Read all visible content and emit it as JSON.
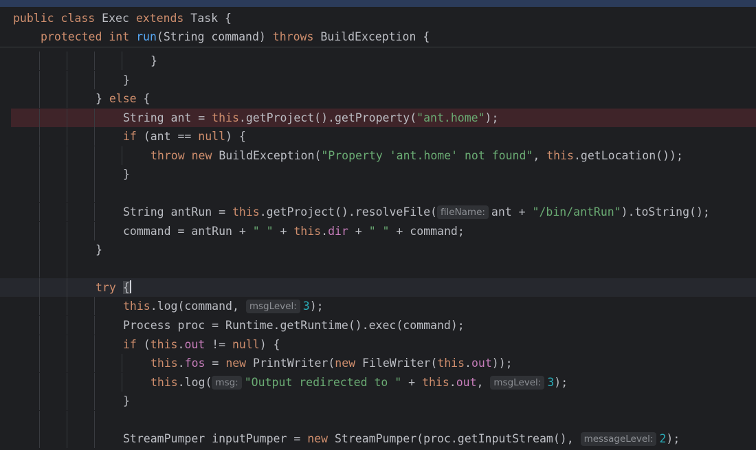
{
  "sticky": {
    "line1": {
      "public": "public",
      "class": "class",
      "name": " Exec ",
      "extends": "extends",
      "task": " Task {"
    },
    "line2": {
      "protected": "protected",
      "int": "int",
      "run": "run",
      "params": "(String command) ",
      "throws": "throws",
      "exc": " BuildException {"
    }
  },
  "code": {
    "l_close_brace1": "}",
    "l_close_brace2": "}",
    "l_else": {
      "brace": "} ",
      "else": "else",
      "open": " {"
    },
    "l_ant": {
      "a": "String ant = ",
      "this": "this",
      "b": ".getProject().getProperty(",
      "str": "\"ant.home\"",
      "c": ");"
    },
    "l_if1": {
      "if": "if",
      "a": " (ant == ",
      "null": "null",
      "b": ") {"
    },
    "l_throw": {
      "throw": "throw",
      "sp": " ",
      "new": "new",
      "a": " BuildException(",
      "str": "\"Property 'ant.home' not found\"",
      "b": ", ",
      "this": "this",
      "c": ".getLocation());"
    },
    "l_close_brace3": "}",
    "l_antrun": {
      "a": "String antRun = ",
      "this": "this",
      "b": ".getProject().resolveFile(",
      "hint": "fileName:",
      "c": "ant + ",
      "str": "\"/bin/antRun\"",
      "d": ").toString();"
    },
    "l_command": {
      "a": "command = antRun + ",
      "s1": "\" \"",
      "b": " + ",
      "this": "this",
      "dot": ".",
      "dir": "dir",
      "c": " + ",
      "s2": "\" \"",
      "d": " + command;"
    },
    "l_close_brace4": "}",
    "l_try": {
      "try": "try",
      "sp": " ",
      "brace": "{"
    },
    "l_log1": {
      "this": "this",
      "a": ".log(command, ",
      "hint": "msgLevel:",
      "num": "3",
      "b": ");"
    },
    "l_proc": {
      "a": "Process proc = Runtime.getRuntime().exec(command);"
    },
    "l_if2": {
      "if": "if",
      "a": " (",
      "this": "this",
      "dot": ".",
      "out": "out",
      "b": " != ",
      "null": "null",
      "c": ") {"
    },
    "l_fos": {
      "this1": "this",
      "dot1": ".",
      "fos": "fos",
      "a": " = ",
      "new1": "new",
      "b": " PrintWriter(",
      "new2": "new",
      "c": " FileWriter(",
      "this2": "this",
      "dot2": ".",
      "out": "out",
      "d": "));"
    },
    "l_log2": {
      "this1": "this",
      "a": ".log(",
      "hint1": "msg:",
      "str": "\"Output redirected to \"",
      "b": " + ",
      "this2": "this",
      "dot": ".",
      "out": "out",
      "c": ", ",
      "hint2": "msgLevel:",
      "num": "3",
      "d": ");"
    },
    "l_close_brace5": "}",
    "l_pumper": {
      "a": "StreamPumper inputPumper = ",
      "new": "new",
      "b": " StreamPumper(proc.getInputStream(), ",
      "hint": "messageLevel:",
      "num": "2",
      "c": ");"
    }
  }
}
